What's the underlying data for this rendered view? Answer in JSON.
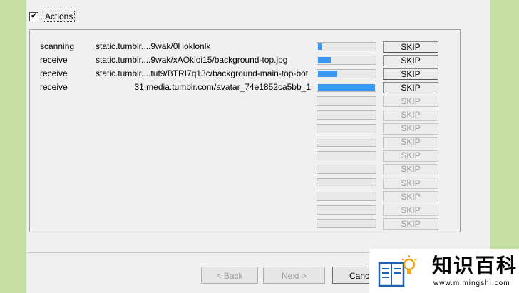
{
  "actions_checkbox": {
    "checked": true,
    "mark": "✔",
    "label": "Actions"
  },
  "transfers": [
    {
      "action": "scanning",
      "url": "static.tumblr....9wak/0Hoklonlk",
      "align": "left",
      "progress": 0.06,
      "skip": "SKIP",
      "enabled": true
    },
    {
      "action": "receive",
      "url": "static.tumblr....9wak/xAOkloi15/background-top.jpg",
      "align": "left",
      "progress": 0.22,
      "skip": "SKIP",
      "enabled": true
    },
    {
      "action": "receive",
      "url": "static.tumblr....tuf9/BTRI7q13c/background-main-top-bot",
      "align": "left",
      "progress": 0.33,
      "skip": "SKIP",
      "enabled": true
    },
    {
      "action": "receive",
      "url": "31.media.tumblr.com/avatar_74e1852ca5bb_1",
      "align": "right",
      "progress": 0.98,
      "skip": "SKIP",
      "enabled": true
    },
    {
      "action": "",
      "url": "",
      "align": "left",
      "progress": 0,
      "skip": "SKIP",
      "enabled": false
    },
    {
      "action": "",
      "url": "",
      "align": "left",
      "progress": 0,
      "skip": "SKIP",
      "enabled": false
    },
    {
      "action": "",
      "url": "",
      "align": "left",
      "progress": 0,
      "skip": "SKIP",
      "enabled": false
    },
    {
      "action": "",
      "url": "",
      "align": "left",
      "progress": 0,
      "skip": "SKIP",
      "enabled": false
    },
    {
      "action": "",
      "url": "",
      "align": "left",
      "progress": 0,
      "skip": "SKIP",
      "enabled": false
    },
    {
      "action": "",
      "url": "",
      "align": "left",
      "progress": 0,
      "skip": "SKIP",
      "enabled": false
    },
    {
      "action": "",
      "url": "",
      "align": "left",
      "progress": 0,
      "skip": "SKIP",
      "enabled": false
    },
    {
      "action": "",
      "url": "",
      "align": "left",
      "progress": 0,
      "skip": "SKIP",
      "enabled": false
    },
    {
      "action": "",
      "url": "",
      "align": "left",
      "progress": 0,
      "skip": "SKIP",
      "enabled": false
    },
    {
      "action": "",
      "url": "",
      "align": "left",
      "progress": 0,
      "skip": "SKIP",
      "enabled": false
    }
  ],
  "footer": {
    "back_label": "< Back",
    "next_label": "Next >",
    "cancel_label": "Canc"
  },
  "watermark": {
    "logo_icon": "book-lightbulb-icon",
    "title": "知识百科",
    "url": "www.mimingshi.com"
  },
  "colors": {
    "background": "#c5e0a2",
    "dialog": "#f0f0f0",
    "progress_fill": "#3c97f0",
    "disabled_text": "#9c9c9c"
  }
}
